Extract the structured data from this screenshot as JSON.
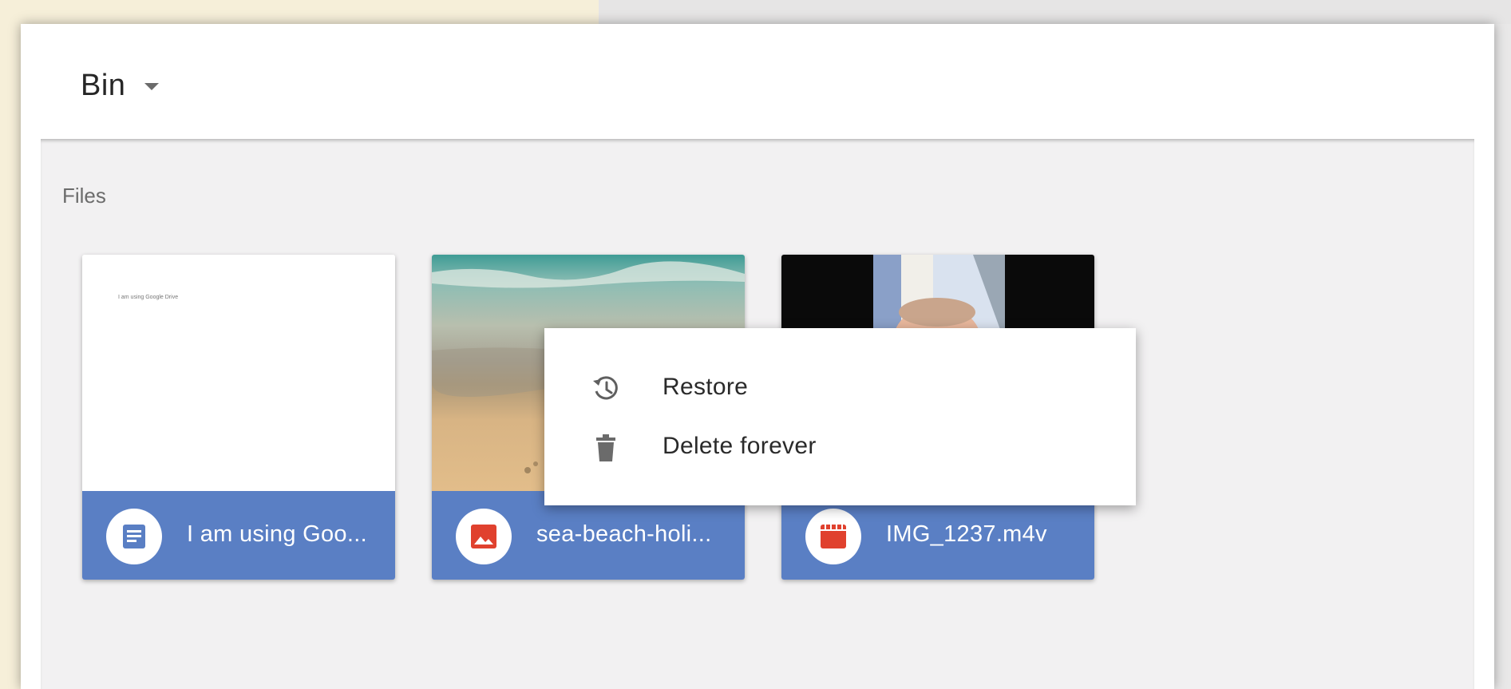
{
  "header": {
    "title": "Bin"
  },
  "section": {
    "label": "Files"
  },
  "files": [
    {
      "name": "I am using Goo...",
      "type_icon": "doc-icon",
      "preview_text": "I am using Google Drive"
    },
    {
      "name": "sea-beach-holi...",
      "type_icon": "image-icon"
    },
    {
      "name": "IMG_1237.m4v",
      "type_icon": "video-icon"
    }
  ],
  "context_menu": {
    "items": [
      {
        "label": "Restore",
        "icon": "restore-icon"
      },
      {
        "label": "Delete forever",
        "icon": "trash-icon"
      }
    ]
  },
  "colors": {
    "card_footer": "#5a7fc4",
    "image_icon": "#e0412e",
    "video_icon": "#e0412e",
    "doc_icon": "#5a7fc4"
  }
}
